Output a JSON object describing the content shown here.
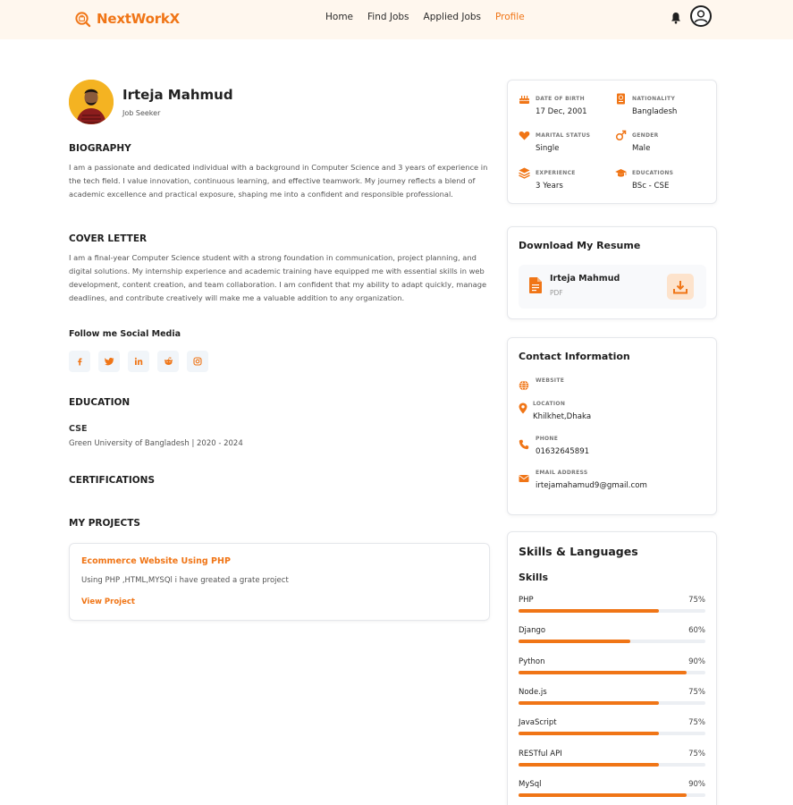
{
  "brand": {
    "name": "NextWorkX",
    "accent": "#f07516"
  },
  "nav": {
    "items": [
      {
        "label": "Home",
        "active": false
      },
      {
        "label": "Find Jobs",
        "active": false
      },
      {
        "label": "Applied Jobs",
        "active": false
      },
      {
        "label": "Profile",
        "active": true
      }
    ]
  },
  "profile": {
    "name": "Irteja Mahmud",
    "role": "Job Seeker",
    "biography_title": "BIOGRAPHY",
    "biography": "I am a passionate and dedicated individual with a background in Computer Science and 3 years of experience in the tech field. I value innovation, continuous learning, and effective teamwork. My journey reflects a blend of academic excellence and practical exposure, shaping me into a confident and responsible professional.",
    "cover_title": "COVER LETTER",
    "cover_letter": "I am a final-year Computer Science student with a strong foundation in communication, project planning, and digital solutions. My internship experience and academic training have equipped me with essential skills in web development, content creation, and team collaboration. I am confident that my ability to adapt quickly, manage deadlines, and contribute creatively will make me a valuable addition to any organization.",
    "social_title": "Follow me Social Media",
    "socials": [
      "facebook-icon",
      "twitter-icon",
      "linkedin-icon",
      "reddit-icon",
      "instagram-icon"
    ],
    "education_title": "EDUCATION",
    "education": {
      "degree": "CSE",
      "school": "Green University of Bangladesh | 2020 - 2024"
    },
    "certifications_title": "CERTIFICATIONS",
    "projects_title": "MY PROJECTS",
    "projects": [
      {
        "title": "Ecommerce Website Using PHP",
        "description": "Using PHP ,HTML,MYSQl i have greated a grate project",
        "link": "View Project"
      }
    ]
  },
  "overview": {
    "dob_label": "DATE OF BIRTH",
    "dob": "17 Dec, 2001",
    "nationality_label": "NATIONALITY",
    "nationality": "Bangladesh",
    "marital_label": "MARITAL STATUS",
    "marital": "Single",
    "gender_label": "GENDER",
    "gender": "Male",
    "experience_label": "EXPERIENCE",
    "experience": "3 Years",
    "education_label": "EDUCATIONS",
    "education": "BSc - CSE"
  },
  "resume": {
    "title": "Download My Resume",
    "file_name": "Irteja Mahmud",
    "file_type": "PDF"
  },
  "contact": {
    "title": "Contact Information",
    "website_label": "WEBSITE",
    "website": "",
    "location_label": "LOCATION",
    "location": "Khilkhet,Dhaka",
    "phone_label": "PHONE",
    "phone": "01632645891",
    "email_label": "EMAIL ADDRESS",
    "email": "irtejamahamud9@gmail.com"
  },
  "skills": {
    "title": "Skills & Languages",
    "subtitle": "Skills",
    "items": [
      {
        "name": "PHP",
        "percent": "75%",
        "level": 75
      },
      {
        "name": "Django",
        "percent": "60%",
        "level": 60
      },
      {
        "name": "Python",
        "percent": "90%",
        "level": 90
      },
      {
        "name": "Node.js",
        "percent": "75%",
        "level": 75
      },
      {
        "name": "JavaScript",
        "percent": "75%",
        "level": 75
      },
      {
        "name": "RESTful API",
        "percent": "75%",
        "level": 75
      },
      {
        "name": "MySql",
        "percent": "90%",
        "level": 90
      }
    ]
  }
}
